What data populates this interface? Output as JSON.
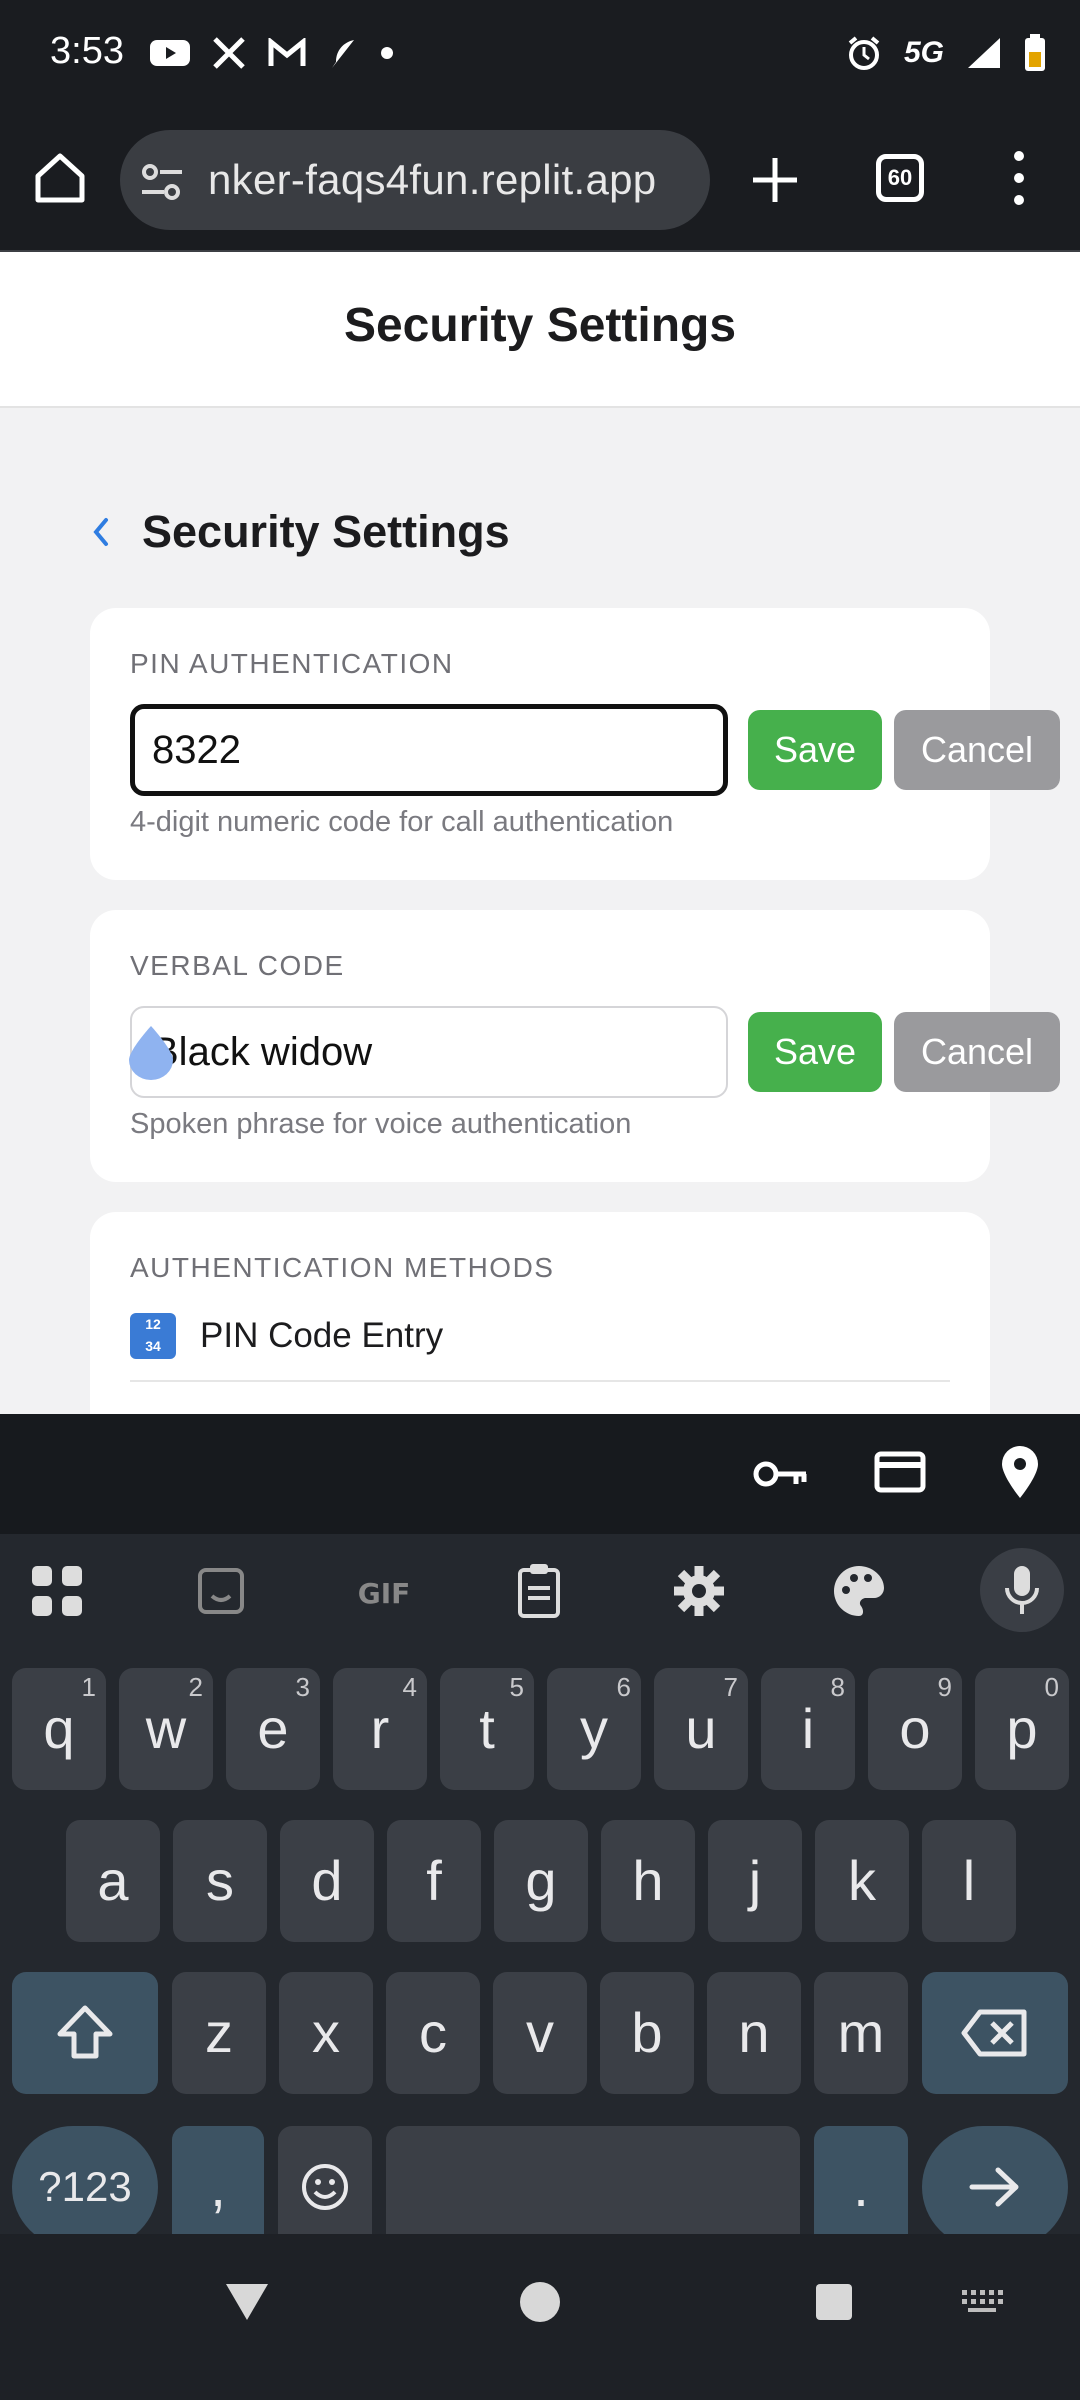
{
  "status_bar": {
    "time": "3:53",
    "network": "5G",
    "left_icons": [
      "youtube-icon",
      "x-icon",
      "gmail-icon",
      "feather-icon",
      "dot-icon"
    ],
    "right_icons": [
      "alarm-icon",
      "signal-icon",
      "battery-icon"
    ]
  },
  "browser": {
    "url": "nker-faqs4fun.replit.app",
    "tab_count": "60"
  },
  "page": {
    "header_title": "Security Settings",
    "sub_title": "Security Settings",
    "pin": {
      "label": "PIN AUTHENTICATION",
      "value": "8322",
      "save_label": "Save",
      "cancel_label": "Cancel",
      "hint": "4-digit numeric code for call authentication"
    },
    "verbal": {
      "label": "VERBAL CODE",
      "value": "Black widow",
      "save_label": "Save",
      "cancel_label": "Cancel",
      "hint": "Spoken phrase for voice authentication"
    },
    "methods": {
      "label": "AUTHENTICATION METHODS",
      "items": [
        {
          "icon": "numbers-icon",
          "label": "PIN Code Entry"
        }
      ]
    }
  },
  "keyboard": {
    "row1": [
      {
        "k": "q",
        "n": "1"
      },
      {
        "k": "w",
        "n": "2"
      },
      {
        "k": "e",
        "n": "3"
      },
      {
        "k": "r",
        "n": "4"
      },
      {
        "k": "t",
        "n": "5"
      },
      {
        "k": "y",
        "n": "6"
      },
      {
        "k": "u",
        "n": "7"
      },
      {
        "k": "i",
        "n": "8"
      },
      {
        "k": "o",
        "n": "9"
      },
      {
        "k": "p",
        "n": "0"
      }
    ],
    "row2": [
      "a",
      "s",
      "d",
      "f",
      "g",
      "h",
      "j",
      "k",
      "l"
    ],
    "row3": [
      "z",
      "x",
      "c",
      "v",
      "b",
      "n",
      "m"
    ],
    "symbols_label": "?123",
    "comma": ",",
    "period": "."
  }
}
